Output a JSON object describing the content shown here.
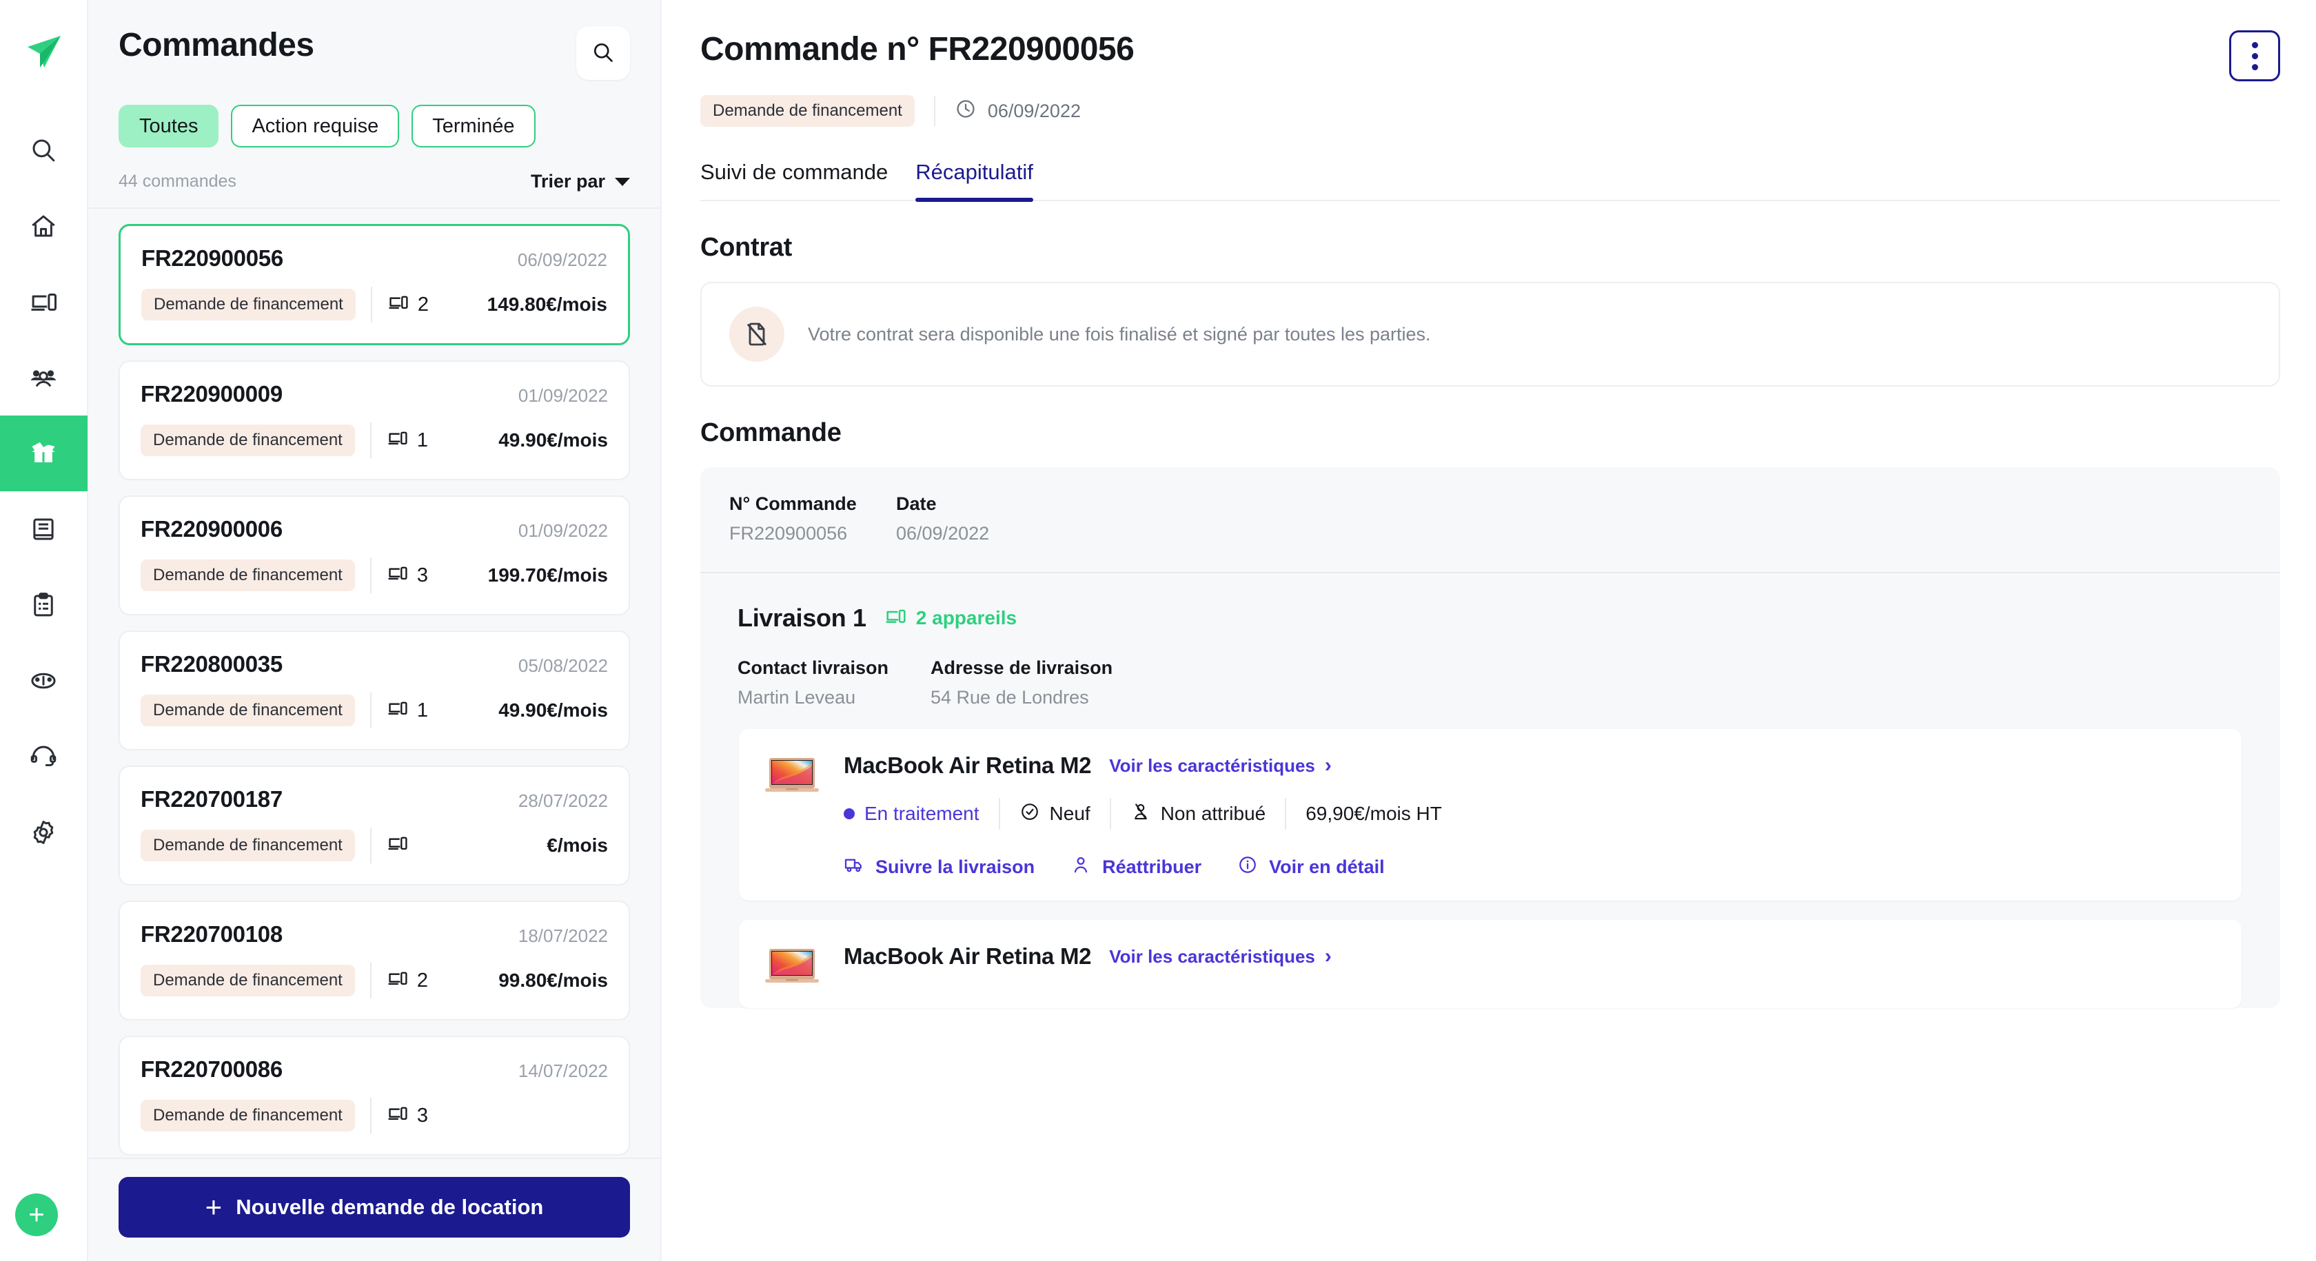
{
  "rail": {
    "logo_icon": "app-logo-paperplane",
    "items": [
      {
        "icon": "search-icon",
        "name": "search",
        "active": false
      },
      {
        "icon": "home-icon",
        "name": "home",
        "active": false
      },
      {
        "icon": "devices-icon",
        "name": "devices",
        "active": false
      },
      {
        "icon": "users-icon",
        "name": "users",
        "active": false
      },
      {
        "icon": "box-open-icon",
        "name": "orders",
        "active": true
      },
      {
        "icon": "book-icon",
        "name": "catalog",
        "active": false
      },
      {
        "icon": "clipboard-icon",
        "name": "requests",
        "active": false
      },
      {
        "icon": "gauge-icon",
        "name": "dashboard",
        "active": false
      },
      {
        "icon": "headset-icon",
        "name": "support",
        "active": false
      },
      {
        "icon": "gear-icon",
        "name": "settings",
        "active": false
      }
    ],
    "fab_label": "+"
  },
  "list": {
    "title": "Commandes",
    "search_icon": "search-icon",
    "filters": [
      {
        "label": "Toutes",
        "selected": true
      },
      {
        "label": "Action requise",
        "selected": false
      },
      {
        "label": "Terminée",
        "selected": false
      }
    ],
    "count_text": "44 commandes",
    "sort_label": "Trier par",
    "orders": [
      {
        "id": "FR220900056",
        "date": "06/09/2022",
        "status": "Demande de financement",
        "devices": "2",
        "price": "149.80€/mois",
        "selected": true
      },
      {
        "id": "FR220900009",
        "date": "01/09/2022",
        "status": "Demande de financement",
        "devices": "1",
        "price": "49.90€/mois",
        "selected": false
      },
      {
        "id": "FR220900006",
        "date": "01/09/2022",
        "status": "Demande de financement",
        "devices": "3",
        "price": "199.70€/mois",
        "selected": false
      },
      {
        "id": "FR220800035",
        "date": "05/08/2022",
        "status": "Demande de financement",
        "devices": "1",
        "price": "49.90€/mois",
        "selected": false
      },
      {
        "id": "FR220700187",
        "date": "28/07/2022",
        "status": "Demande de financement",
        "devices": "",
        "price": "€/mois",
        "selected": false
      },
      {
        "id": "FR220700108",
        "date": "18/07/2022",
        "status": "Demande de financement",
        "devices": "2",
        "price": "99.80€/mois",
        "selected": false
      },
      {
        "id": "FR220700086",
        "date": "14/07/2022",
        "status": "Demande de financement",
        "devices": "3",
        "price": "",
        "selected": false
      }
    ],
    "cta_label": "Nouvelle demande de location",
    "cta_plus": "+"
  },
  "detail": {
    "title": "Commande n° FR220900056",
    "status_badge": "Demande de financement",
    "date_icon": "clock-icon",
    "date": "06/09/2022",
    "kebab_icon": "more-vertical-icon",
    "tabs": [
      {
        "label": "Suivi de commande",
        "active": false
      },
      {
        "label": "Récapitulatif",
        "active": true
      }
    ],
    "contract": {
      "heading": "Contrat",
      "icon": "file-off-icon",
      "message": "Votre contrat sera disponible une fois finalisé et signé par toutes les parties."
    },
    "order": {
      "heading": "Commande",
      "fields": [
        {
          "label": "N° Commande",
          "value": "FR220900056"
        },
        {
          "label": "Date",
          "value": "06/09/2022"
        }
      ]
    },
    "delivery": {
      "title": "Livraison 1",
      "devices_icon": "devices-icon",
      "devices_label": "2 appareils",
      "fields": [
        {
          "label": "Contact livraison",
          "value": "Martin Leveau"
        },
        {
          "label": "Adresse de livraison",
          "value": "54 Rue de Londres"
        }
      ],
      "products": [
        {
          "thumb": "macbook-air-thumbnail",
          "name": "MacBook Air Retina M2",
          "spec_link": "Voir les caractéristiques",
          "chevron": "›",
          "status": "En traitement",
          "condition": "Neuf",
          "condition_icon": "check-circle-icon",
          "assignment": "Non attribué",
          "assignment_icon": "user-off-icon",
          "price": "69,90€/mois HT",
          "actions": [
            {
              "label": "Suivre la livraison",
              "icon": "truck-icon"
            },
            {
              "label": "Réattribuer",
              "icon": "user-icon"
            },
            {
              "label": "Voir en détail",
              "icon": "info-icon"
            }
          ]
        },
        {
          "thumb": "macbook-air-thumbnail",
          "name": "MacBook Air Retina M2",
          "spec_link": "Voir les caractéristiques",
          "chevron": "›"
        }
      ]
    }
  },
  "colors": {
    "green": "#2ed07f",
    "green_light": "#9df0c4",
    "navy": "#1b1a8f",
    "purple": "#4a35d9",
    "badge_bg": "#f9ece5",
    "panel_bg": "#f7f8fa"
  }
}
